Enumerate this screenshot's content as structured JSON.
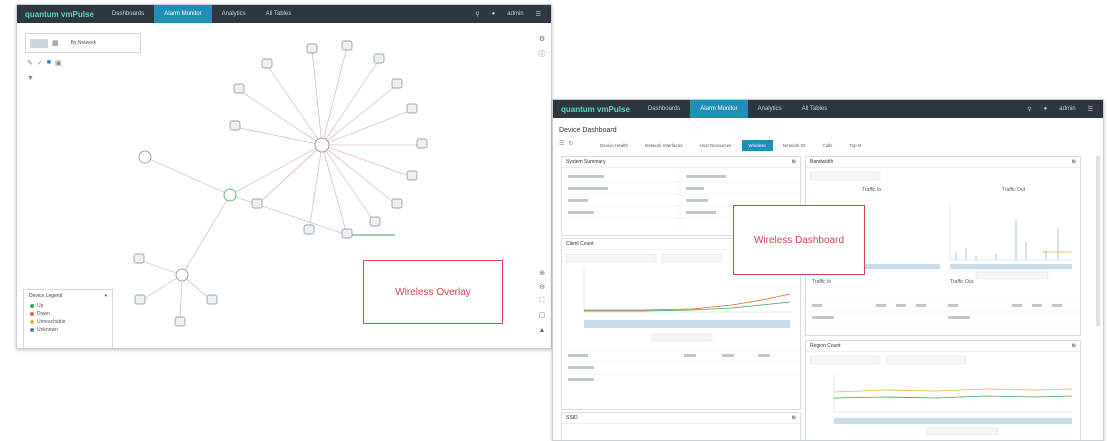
{
  "app": {
    "brand": "quantum vmPulse",
    "nav_tabs": [
      "Dashboards",
      "Alarm Monitor",
      "Analytics",
      "All Tables"
    ],
    "active_nav_index": 1,
    "user": "admin"
  },
  "overlay_window": {
    "view_selector": "By Network",
    "legend": {
      "title": "Device Legend",
      "items": [
        {
          "label": "Up",
          "color": "#3aa655"
        },
        {
          "label": "Down",
          "color": "#e06b1f"
        },
        {
          "label": "Unreachable",
          "color": "#e8b62e"
        },
        {
          "label": "Unknown",
          "color": "#6b7a8c"
        }
      ]
    },
    "callout": "Wireless Overlay"
  },
  "dashboard_window": {
    "title": "Device Dashboard",
    "sub_tabs": [
      "Device Health",
      "Network Interfaces",
      "Host Resources",
      "Wireless",
      "Network IO",
      "Calls",
      "Top N"
    ],
    "active_sub_tab": 3,
    "panels": {
      "system_summary": "System Summary",
      "client_count": "Client Count",
      "bandwidth": "Bandwidth",
      "traffic_in": "Traffic In",
      "traffic_out": "Traffic Out",
      "region_count": "Region Count",
      "ssid": "SSID"
    },
    "callout": "Wireless Dashboard"
  },
  "colors": {
    "accent": "#1f8fb5",
    "topbar": "#2e3740",
    "callout": "#d9434f"
  }
}
